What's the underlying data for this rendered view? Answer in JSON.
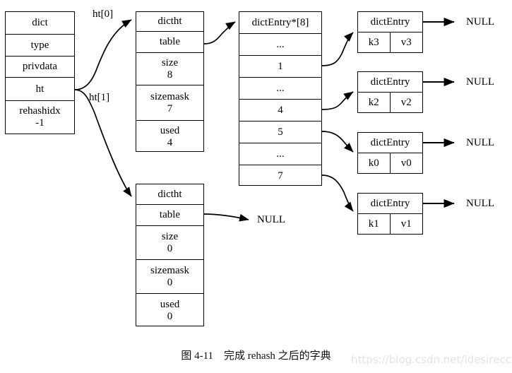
{
  "figure": {
    "caption": "图 4-11　完成 rehash 之后的字典",
    "watermark": "https://blog.csdn.net/idesireccx"
  },
  "dict_struct": {
    "title": "dict",
    "fields": [
      {
        "name": "type",
        "value": ""
      },
      {
        "name": "privdata",
        "value": ""
      },
      {
        "name": "ht",
        "value": ""
      },
      {
        "name": "rehashidx",
        "value": "-1"
      }
    ]
  },
  "pointer_labels": {
    "ht0": "ht[0]",
    "ht1": "ht[1]"
  },
  "ht0": {
    "title": "dictht",
    "fields": [
      {
        "name": "table",
        "value": ""
      },
      {
        "name": "size",
        "value": "8"
      },
      {
        "name": "sizemask",
        "value": "7"
      },
      {
        "name": "used",
        "value": "4"
      }
    ]
  },
  "ht1": {
    "title": "dictht",
    "fields": [
      {
        "name": "table",
        "value": ""
      },
      {
        "name": "size",
        "value": "0"
      },
      {
        "name": "sizemask",
        "value": "0"
      },
      {
        "name": "used",
        "value": "0"
      }
    ],
    "table_target": "NULL"
  },
  "bucket_table": {
    "title": "dictEntry*[8]",
    "slots": [
      "...",
      "1",
      "...",
      "4",
      "5",
      "...",
      "7"
    ]
  },
  "entries": [
    {
      "title": "dictEntry",
      "key": "k3",
      "value": "v3",
      "next": "NULL"
    },
    {
      "title": "dictEntry",
      "key": "k2",
      "value": "v2",
      "next": "NULL"
    },
    {
      "title": "dictEntry",
      "key": "k0",
      "value": "v0",
      "next": "NULL"
    },
    {
      "title": "dictEntry",
      "key": "k1",
      "value": "v1",
      "next": "NULL"
    }
  ],
  "colors": {
    "stroke": "#000000",
    "background": "#ffffff",
    "watermark": "#e3e3e3"
  }
}
